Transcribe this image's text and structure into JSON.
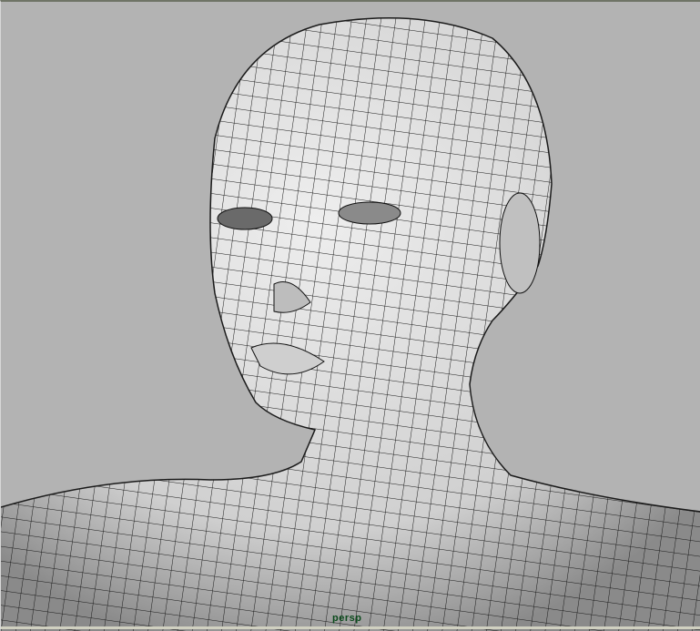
{
  "viewport": {
    "camera_label": "persp",
    "background_color": "#b3b3b3",
    "mesh_color": "#e2e2e2",
    "wire_color": "#1a1a1a"
  }
}
